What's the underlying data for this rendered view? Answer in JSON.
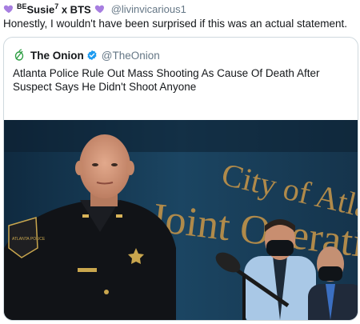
{
  "tweet": {
    "display_name": "Susie",
    "display_name_prefix": "BE",
    "display_name_sup": "7",
    "display_name_suffix": "x BTS",
    "handle": "@livinvicarious1",
    "text": "Honestly, I wouldn't have been surprised if this was an actual statement."
  },
  "quoted": {
    "name": "The Onion",
    "handle": "@TheOnion",
    "text": "Atlanta Police Rule Out Mass Shooting As Cause Of Death After Suspect Says He Didn't Shoot Anyone",
    "photo": {
      "backdrop_line1": "City of Atlanta",
      "backdrop_line2": "Joint Operations C",
      "badge_text": "ATLANTA POLICE"
    }
  },
  "colors": {
    "heart": "#a77ee0",
    "verified": "#1d9bf0",
    "onion_logo": "#2f9e44",
    "handle": "#657786",
    "backdrop": "#16364f",
    "backdrop_letters": "#b08a4a"
  },
  "icons": {
    "heart": "purple-heart-icon",
    "verified": "verified-badge-icon",
    "logo": "onion-logo-icon"
  }
}
